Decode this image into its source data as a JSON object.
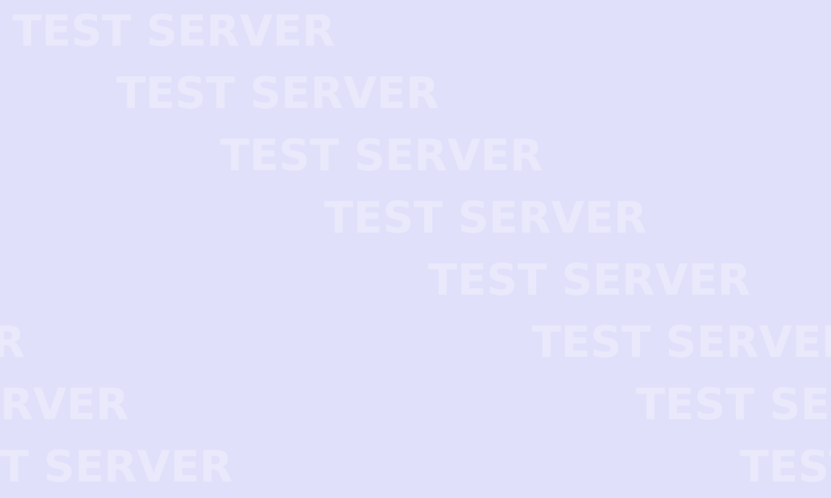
{
  "background_color": "#e0e0fb",
  "watermark": {
    "text": "TEST SERVER",
    "color": "#e9e9fb"
  }
}
